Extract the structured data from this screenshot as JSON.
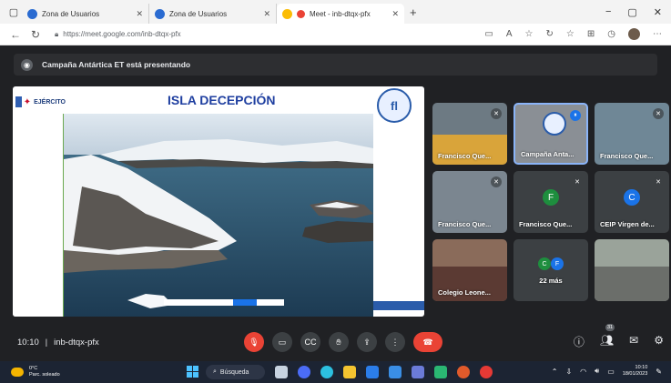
{
  "browser": {
    "tabs": [
      {
        "label": "Zona de Usuarios",
        "active": false
      },
      {
        "label": "Zona de Usuarios",
        "active": false
      },
      {
        "label": "Meet - inb-dtqx-pfx",
        "active": true
      }
    ],
    "url": "https://meet.google.com/inb-dtqx-pfx",
    "controls": {
      "minimize": "−",
      "maximize": "▢",
      "close": "✕"
    }
  },
  "meet": {
    "banner": "Campaña Antártica ET está presentando",
    "presentation": {
      "logo_text": "EJÉRCITO",
      "title": "ISLA DECEPCIÓN",
      "seal_text": "fl"
    },
    "tiles": [
      {
        "name": "Francisco Que...",
        "muted": true
      },
      {
        "name": "Campaña Anta...",
        "muted": false,
        "speaking": true
      },
      {
        "name": "Francisco Que...",
        "muted": true
      },
      {
        "name": "Francisco Que...",
        "muted": true
      },
      {
        "name": "Francisco Que...",
        "muted": true,
        "avatar": "F",
        "avatar_color": "#1e8e3e"
      },
      {
        "name": "CEIP Virgen de...",
        "muted": true,
        "avatar": "C",
        "avatar_color": "#1a73e8"
      },
      {
        "name": "Colegio Leone...",
        "muted": false
      },
      {
        "name": "22 más",
        "avatars": [
          "C",
          "F"
        ]
      },
      {
        "name": "",
        "muted": false
      }
    ],
    "bottom": {
      "time": "10:10",
      "separator": "|",
      "meeting_code": "inb-dtqx-pfx",
      "participants_badge": "31"
    }
  },
  "taskbar": {
    "temperature": "0°C",
    "weather": "Parc. soleado",
    "search": "Búsqueda",
    "clock_time": "10:10",
    "clock_date": "18/01/2023"
  },
  "colors": {
    "meet_bg": "#202124",
    "tile_bg": "#3c4043",
    "end_call": "#ea4335",
    "title_blue": "#1f3fa0"
  }
}
